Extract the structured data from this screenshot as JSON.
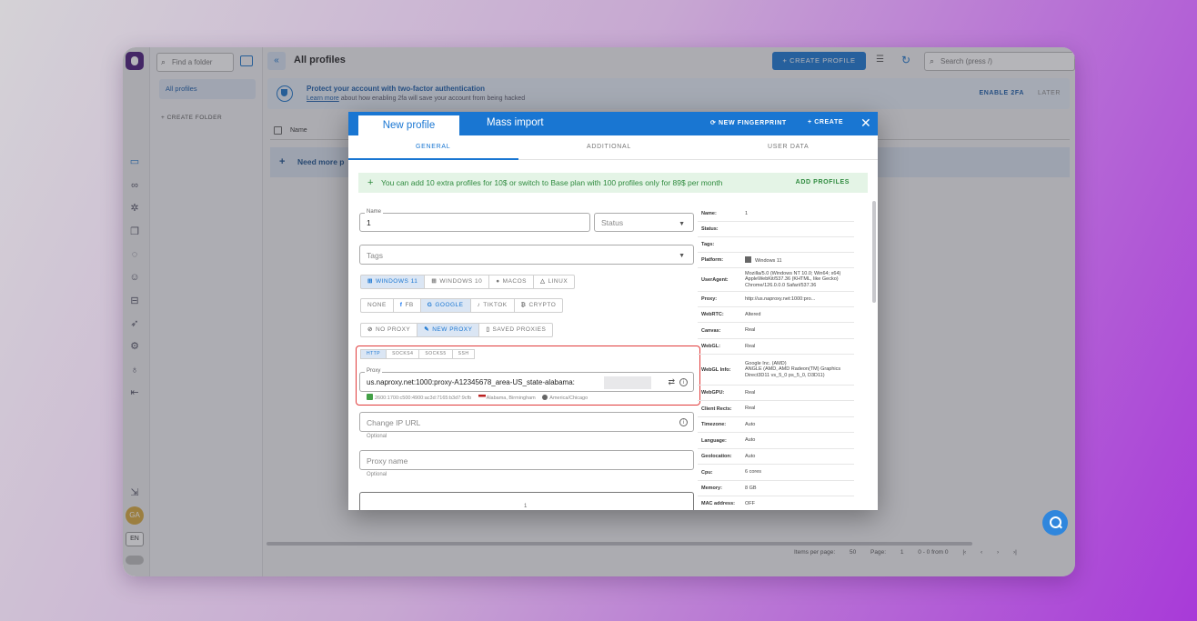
{
  "sidebar": {
    "lang": "EN",
    "avatar_initials": "GA",
    "find_folder_placeholder": "Find a folder",
    "all_profiles": "All profiles",
    "create_folder": "+ CREATE FOLDER"
  },
  "header": {
    "title": "All profiles",
    "create_profile": "+ CREATE PROFILE",
    "search_placeholder": "Search (press /)"
  },
  "twofa": {
    "title": "Protect your account with two-factor authentication",
    "learn_more": "Learn more",
    "subtitle": "about how enabling 2fa will save your account from being hacked",
    "enable": "ENABLE 2FA",
    "later": "LATER"
  },
  "table": {
    "name_col": "Name",
    "need_more": "Need more p"
  },
  "pager": {
    "items_per_page": "Items per page:",
    "per_page_value": "50",
    "page_label": "Page:",
    "page_value": "1",
    "range": "0 - 0 from 0"
  },
  "modal": {
    "tab_new": "New profile",
    "tab_mass": "Mass import",
    "new_fingerprint": "NEW FINGERPRINT",
    "create": "+ CREATE",
    "close": "✕",
    "subtabs": [
      "GENERAL",
      "ADDITIONAL",
      "USER DATA"
    ],
    "promo_text": "You can add 10 extra profiles for 10$ or switch to Base plan with 100 profiles only for 89$ per month",
    "promo_action": "ADD PROFILES",
    "name_label": "Name",
    "name_value": "1",
    "status_placeholder": "Status",
    "tags_placeholder": "Tags",
    "os_options": [
      {
        "label": "WINDOWS 11",
        "icon": "windows-icon",
        "selected": true
      },
      {
        "label": "WINDOWS 10",
        "icon": "windows-icon",
        "selected": false
      },
      {
        "label": "MACOS",
        "icon": "apple-icon",
        "selected": false
      },
      {
        "label": "LINUX",
        "icon": "linux-icon",
        "selected": false
      }
    ],
    "cookie_options": [
      {
        "label": "NONE",
        "icon": "",
        "selected": false
      },
      {
        "label": "FB",
        "icon": "facebook-icon",
        "selected": false
      },
      {
        "label": "GOOGLE",
        "icon": "google-icon",
        "selected": true
      },
      {
        "label": "TIKTOK",
        "icon": "tiktok-icon",
        "selected": false
      },
      {
        "label": "CRYPTO",
        "icon": "bitcoin-icon",
        "selected": false
      }
    ],
    "proxy_mode_options": [
      {
        "label": "NO PROXY",
        "icon": "block-icon",
        "selected": false
      },
      {
        "label": "NEW PROXY",
        "icon": "edit-icon",
        "selected": true
      },
      {
        "label": "SAVED PROXIES",
        "icon": "bookmark-icon",
        "selected": false
      }
    ],
    "proxy_protocols": [
      {
        "label": "HTTP",
        "selected": true
      },
      {
        "label": "SOCKS4",
        "selected": false
      },
      {
        "label": "SOCKS5",
        "selected": false
      },
      {
        "label": "SSH",
        "selected": false
      }
    ],
    "proxy_label": "Proxy",
    "proxy_value": "us.naproxy.net:1000:proxy-A12345678_area-US_state-alabama:",
    "proxy_ip": "2600:1700:c500:4900:ac3d:7165:b3d7:9cfb",
    "proxy_location": "Alabama, Birmingham",
    "proxy_timezone": "America/Chicago",
    "change_ip_placeholder": "Change IP URL",
    "optional": "Optional",
    "proxy_name_placeholder": "Proxy name",
    "notes_value": "1"
  },
  "summary": [
    {
      "k": "Name:",
      "v": "1"
    },
    {
      "k": "Status:",
      "v": ""
    },
    {
      "k": "Tags:",
      "v": ""
    },
    {
      "k": "Platform:",
      "v": "Windows 11"
    },
    {
      "k": "UserAgent:",
      "v": "Mozilla/5.0 (Windows NT 10.0; Win64; x64) AppleWebKit/537.36 (KHTML, like Gecko) Chrome/126.0.0.0 Safari/537.36"
    },
    {
      "k": "Proxy:",
      "v": "http://us.naproxy.net:1000:pro..."
    },
    {
      "k": "WebRTC:",
      "v": "Altered"
    },
    {
      "k": "Canvas:",
      "v": "Real"
    },
    {
      "k": "WebGL:",
      "v": "Real"
    },
    {
      "k": "WebGL Info:",
      "v": "Google Inc. (AMD)\nANGLE (AMD, AMD Radeon(TM) Graphics Direct3D11 vs_5_0 ps_5_0, D3D11)"
    },
    {
      "k": "WebGPU:",
      "v": "Real"
    },
    {
      "k": "Client Rects:",
      "v": "Real"
    },
    {
      "k": "Timezone:",
      "v": "Auto"
    },
    {
      "k": "Language:",
      "v": "Auto"
    },
    {
      "k": "Geolocation:",
      "v": "Auto"
    },
    {
      "k": "Cpu:",
      "v": "6 cores"
    },
    {
      "k": "Memory:",
      "v": "8 GB"
    },
    {
      "k": "MAC address:",
      "v": "OFF"
    }
  ]
}
